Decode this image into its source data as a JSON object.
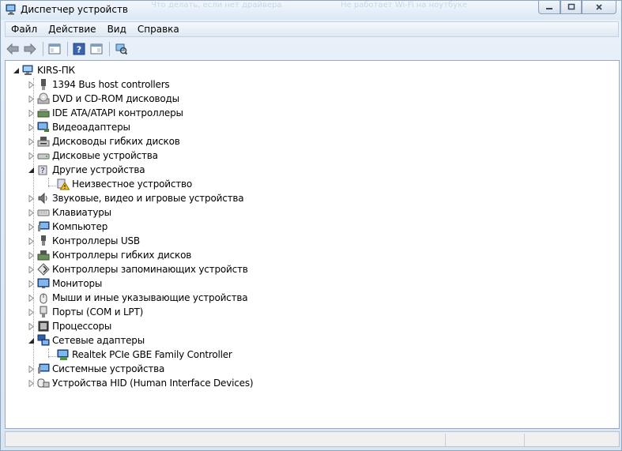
{
  "window": {
    "title": "Диспетчер устройств",
    "background_tabs": [
      "Что делать, если нет драйвера",
      "Не работает Wi-Fi на ноутбуке"
    ]
  },
  "menu": {
    "items": [
      "Файл",
      "Действие",
      "Вид",
      "Справка"
    ]
  },
  "toolbar": {
    "buttons": [
      "back-arrow-icon",
      "forward-arrow-icon",
      "console-tree-icon",
      "help-icon",
      "properties-icon",
      "scan-hardware-icon"
    ]
  },
  "tree": {
    "root": "KIRS-ПК",
    "categories": [
      {
        "label": "1394 Bus host controllers",
        "icon": "firewire-icon"
      },
      {
        "label": "DVD и CD-ROM дисководы",
        "icon": "cdrom-icon"
      },
      {
        "label": "IDE ATA/ATAPI контроллеры",
        "icon": "ide-controller-icon"
      },
      {
        "label": "Видеоадаптеры",
        "icon": "display-adapter-icon"
      },
      {
        "label": "Дисководы гибких дисков",
        "icon": "floppy-drive-icon"
      },
      {
        "label": "Дисковые устройства",
        "icon": "disk-drive-icon"
      },
      {
        "label": "Другие устройства",
        "icon": "other-devices-icon",
        "expanded": true,
        "children": [
          {
            "label": "Неизвестное устройство",
            "icon": "unknown-device-warning-icon"
          }
        ]
      },
      {
        "label": "Звуковые, видео и игровые устройства",
        "icon": "sound-icon"
      },
      {
        "label": "Клавиатуры",
        "icon": "keyboard-icon"
      },
      {
        "label": "Компьютер",
        "icon": "computer-icon"
      },
      {
        "label": "Контроллеры USB",
        "icon": "usb-icon"
      },
      {
        "label": "Контроллеры гибких дисков",
        "icon": "floppy-controller-icon"
      },
      {
        "label": "Контроллеры запоминающих устройств",
        "icon": "storage-controller-icon"
      },
      {
        "label": "Мониторы",
        "icon": "monitor-icon"
      },
      {
        "label": "Мыши и иные указывающие устройства",
        "icon": "mouse-icon"
      },
      {
        "label": "Порты (COM и LPT)",
        "icon": "port-icon"
      },
      {
        "label": "Процессоры",
        "icon": "processor-icon"
      },
      {
        "label": "Сетевые адаптеры",
        "icon": "network-adapter-icon",
        "expanded": true,
        "children": [
          {
            "label": "Realtek PCIe GBE Family Controller",
            "icon": "network-card-icon"
          }
        ]
      },
      {
        "label": "Системные устройства",
        "icon": "system-devices-icon"
      },
      {
        "label": "Устройства HID (Human Interface Devices)",
        "icon": "hid-icon"
      }
    ]
  },
  "colors": {
    "window_frame": "#dce8f5",
    "tree_background": "#ffffff",
    "warning": "#f5c518"
  }
}
